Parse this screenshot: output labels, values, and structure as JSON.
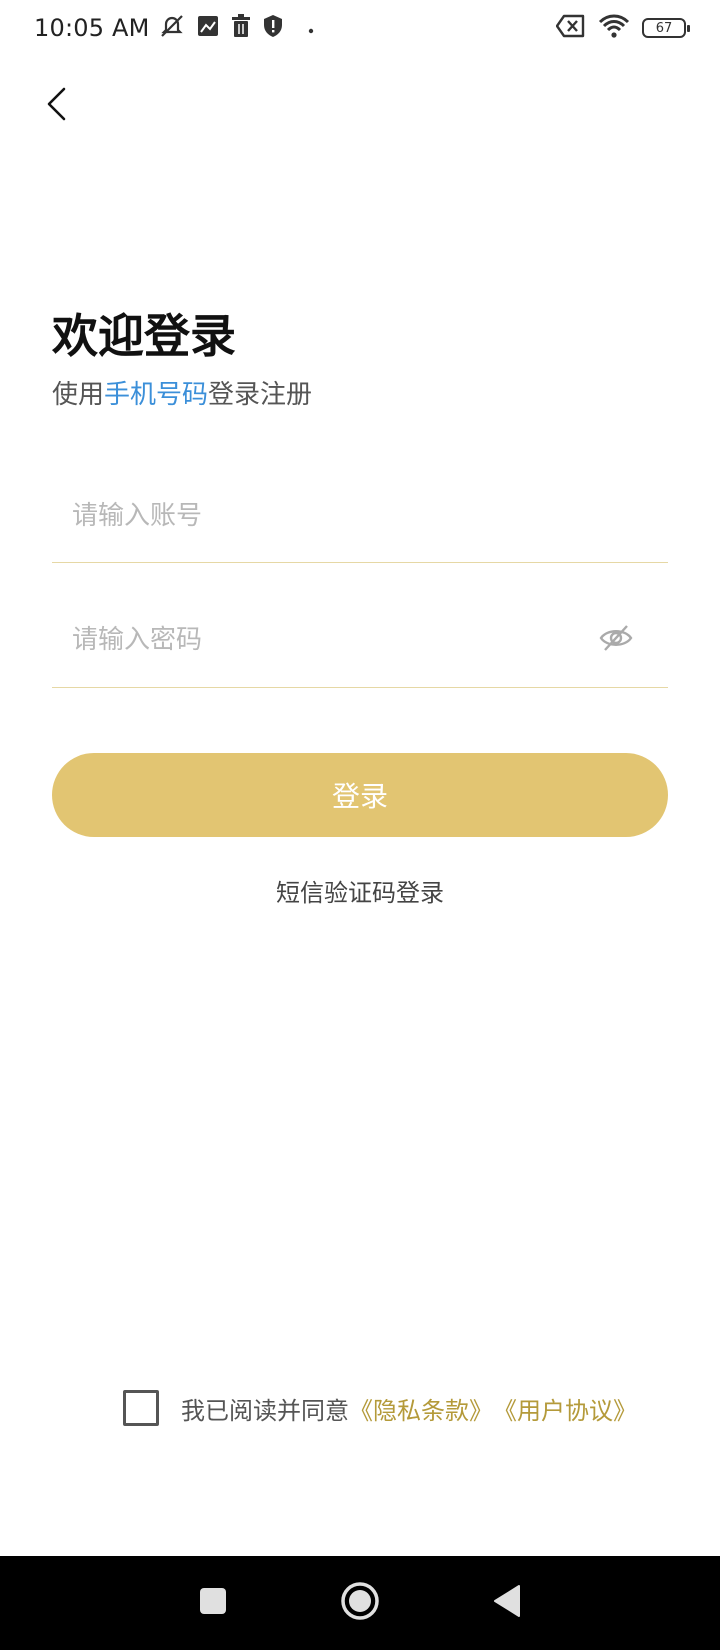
{
  "status_bar": {
    "time": "10:05 AM",
    "battery_level": "67",
    "icons": [
      "mute-icon",
      "photo-icon",
      "trash-icon",
      "shield-icon",
      "dot-icon",
      "sim-error-icon",
      "wifi-icon",
      "battery-icon"
    ]
  },
  "header": {
    "back_icon": "chevron-left-icon"
  },
  "login": {
    "title": "欢迎登录",
    "subtitle_prefix": "使用",
    "subtitle_accent": "手机号码",
    "subtitle_suffix": "登录注册",
    "account_placeholder": "请输入账号",
    "account_value": "",
    "password_placeholder": "请输入密码",
    "password_value": "",
    "password_toggle_icon": "eye-off-icon",
    "login_button": "登录",
    "sms_login_link": "短信验证码登录"
  },
  "agreement": {
    "checked": false,
    "text": "我已阅读并同意",
    "privacy_link": "《隐私条款》",
    "user_agreement_link": "《用户协议》"
  },
  "colors": {
    "accent_gold": "#e2c572",
    "link_gold": "#b49a3a",
    "accent_blue": "#3b8fd9",
    "divider": "#e6d8a5"
  }
}
